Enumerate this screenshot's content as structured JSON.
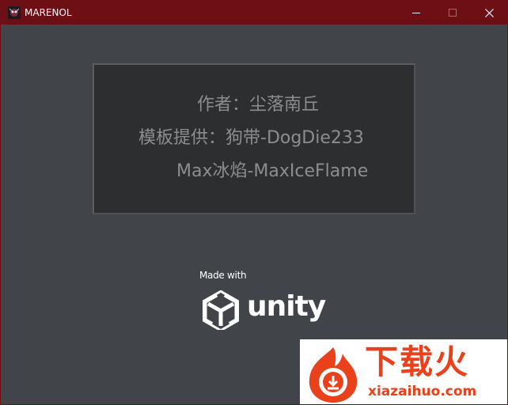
{
  "window": {
    "title": "MARENOL",
    "colors": {
      "titlebar": "#6d0f14",
      "background": "#41454a",
      "panel": "#2d2e30"
    }
  },
  "credits": {
    "author": "作者：尘落南丘",
    "template": "模板提供：狗带-DogDie233",
    "max": "Max冰焰-MaxIceFlame"
  },
  "splash": {
    "made_with": "Made with",
    "engine": "unity"
  },
  "watermark": {
    "brand": "下载火",
    "domain": "xiazaihuo.com",
    "color": "#e8411c"
  },
  "icons": [
    "app-icon",
    "minimize-icon",
    "maximize-icon",
    "close-icon",
    "unity-logo-icon",
    "watermark-logo-icon"
  ]
}
